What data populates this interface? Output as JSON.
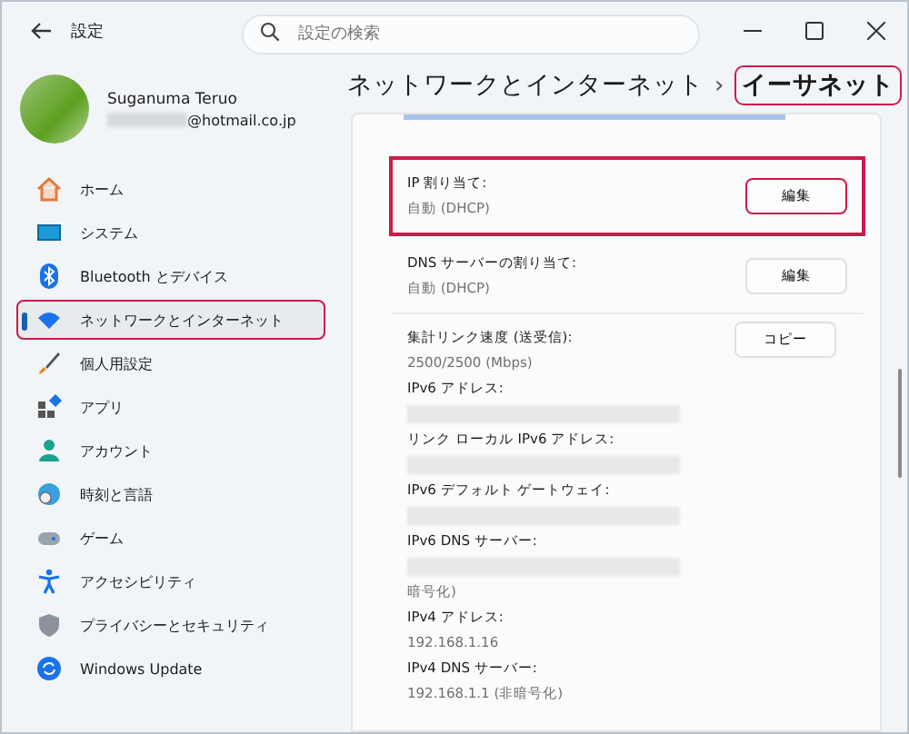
{
  "window": {
    "title": "設定"
  },
  "search": {
    "placeholder": "設定の検索"
  },
  "profile": {
    "name": "Suganuma Teruo",
    "email": "@hotmail.co.jp"
  },
  "nav": [
    {
      "label": "ホーム",
      "selected": false,
      "highlighted": false
    },
    {
      "label": "システム",
      "selected": false,
      "highlighted": false
    },
    {
      "label": "Bluetooth とデバイス",
      "selected": false,
      "highlighted": false
    },
    {
      "label": "ネットワークとインターネット",
      "selected": true,
      "highlighted": true
    },
    {
      "label": "個人用設定",
      "selected": false,
      "highlighted": false
    },
    {
      "label": "アプリ",
      "selected": false,
      "highlighted": false
    },
    {
      "label": "アカウント",
      "selected": false,
      "highlighted": false
    },
    {
      "label": "時刻と言語",
      "selected": false,
      "highlighted": false
    },
    {
      "label": "ゲーム",
      "selected": false,
      "highlighted": false
    },
    {
      "label": "アクセシビリティ",
      "selected": false,
      "highlighted": false
    },
    {
      "label": "プライバシーとセキュリティ",
      "selected": false,
      "highlighted": false
    },
    {
      "label": "Windows Update",
      "selected": false,
      "highlighted": false
    }
  ],
  "breadcrumb": {
    "parent": "ネットワークとインターネット",
    "separator": "›",
    "current": "イーサネット",
    "highlighted": true
  },
  "settings": [
    {
      "label": "IP 割り当て:",
      "value": "自動 (DHCP)",
      "button": "編集",
      "highlighted": true
    },
    {
      "label": "DNS サーバーの割り当て:",
      "value": "自動 (DHCP)",
      "button": "編集",
      "highlighted": false
    }
  ],
  "properties": {
    "button": "コピー",
    "items": [
      {
        "label": "集計リンク速度 (送受信):",
        "value": "2500/2500 (Mbps)"
      },
      {
        "label": "IPv6 アドレス:",
        "redacted": true
      },
      {
        "label": "リンク ローカル IPv6 アドレス:",
        "redacted": true
      },
      {
        "label": "IPv6 デフォルト ゲートウェイ:",
        "redacted": true
      },
      {
        "label": "IPv6 DNS サーバー:",
        "redacted": true,
        "value": "暗号化)"
      },
      {
        "label": "IPv4 アドレス:",
        "value": "192.168.1.16"
      },
      {
        "label": "IPv4 DNS サーバー:",
        "value": "192.168.1.1 (非暗号化)"
      }
    ]
  }
}
